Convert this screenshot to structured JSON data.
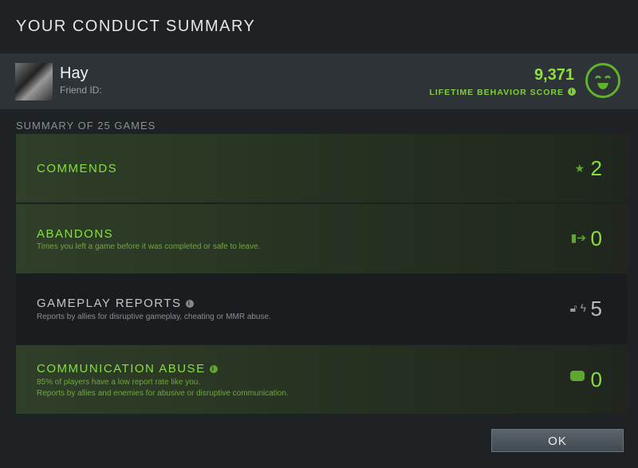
{
  "title": "YOUR CONDUCT SUMMARY",
  "player": {
    "name": "Hay",
    "friend_id_label": "Friend ID:",
    "score": "9,371",
    "score_label": "LIFETIME BEHAVIOR SCORE"
  },
  "summary_label": "SUMMARY OF 25 GAMES",
  "rows": [
    {
      "title": "COMMENDS",
      "value": "2",
      "icon": "star-thumbs-up-icon"
    },
    {
      "title": "ABANDONS",
      "desc": "Times you left a game before it was completed or safe to leave.",
      "value": "0",
      "icon": "exit-door-icon"
    },
    {
      "title": "GAMEPLAY REPORTS",
      "desc": "Reports by allies for disruptive gameplay, cheating or MMR abuse.",
      "value": "5",
      "icon": "lock-lightning-icon"
    },
    {
      "title": "COMMUNICATION ABUSE",
      "desc1": "85% of players have a low report rate like you.",
      "desc2": "Reports by allies and enemies for abusive or disruptive communication.",
      "value": "0",
      "icon": "chat-bubble-icon"
    }
  ],
  "ok_label": "OK",
  "colors": {
    "accent": "#86e03a",
    "background": "#1e2225"
  }
}
